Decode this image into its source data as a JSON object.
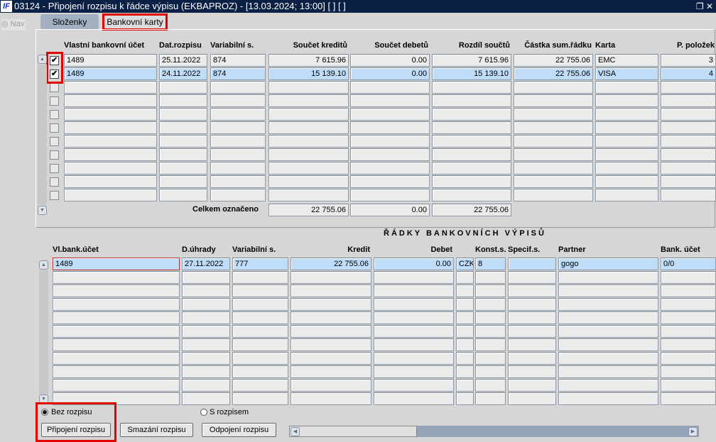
{
  "window": {
    "title": "03124 - Připojení rozpisu k řádce výpisu (EKBAPROZ) - [13.03.2024; 13:00]  [ ]  [ ]",
    "logo": "IF"
  },
  "nav": {
    "label": "Nav"
  },
  "tabs": [
    {
      "label": "Složenky",
      "active": false
    },
    {
      "label": "Bankovní karty",
      "active": true
    }
  ],
  "top_grid": {
    "headers": [
      "Vlastní bankovní účet",
      "Dat.rozpisu",
      "Variabilní s.",
      "Součet kreditů",
      "Součet debetů",
      "Rozdíl součtů",
      "Částka sum.řádku",
      "Karta",
      "P. položek"
    ],
    "rows": [
      {
        "checked": true,
        "cells": [
          "1489",
          "25.11.2022",
          "874",
          "7 615.96",
          "0.00",
          "7 615.96",
          "22 755.06",
          "EMC",
          "3"
        ]
      },
      {
        "checked": true,
        "selected": true,
        "cells": [
          "1489",
          "24.11.2022",
          "874",
          "15 139.10",
          "0.00",
          "15 139.10",
          "22 755.06",
          "VISA",
          "4"
        ]
      }
    ],
    "total_label": "Celkem označeno",
    "totals": [
      "22 755.06",
      "0.00",
      "22 755.06"
    ]
  },
  "bottom_grid": {
    "title": "ŘÁDKY BANKOVNÍCH VÝPISŮ",
    "headers": [
      "Vl.bank.účet",
      "D.úhrady",
      "Variabilní s.",
      "Kredit",
      "Debet",
      "",
      "Konst.s.",
      "Specif.s.",
      "Partner",
      "Bank. účet"
    ],
    "rows": [
      {
        "selected": true,
        "cells": [
          "1489",
          "27.11.2022",
          "777",
          "22 755.06",
          "0.00",
          "CZK",
          "8",
          "",
          "gogo",
          "0/0"
        ]
      }
    ]
  },
  "options": {
    "bez_rozpisu": "Bez rozpisu",
    "s_rozpisem": "S rozpisem",
    "selected": "bez_rozpisu"
  },
  "buttons": {
    "pripojeni": "Připojení rozpisu",
    "smazani": "Smazání rozpisu",
    "odpojeni": "Odpojení rozpisu"
  },
  "colors": {
    "titlebar": "#0a1f44",
    "selected_row": "#bfdcf8",
    "highlight": "#e00000"
  }
}
